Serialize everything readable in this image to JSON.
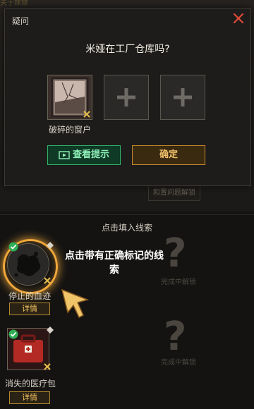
{
  "background": {
    "top_text": "关于妹妹",
    "hint_button": "和置问题解锁",
    "locked_q": "?",
    "locked_sub_1": "完成中解锁",
    "locked_sub_2": "完成中解锁"
  },
  "dialog": {
    "title": "疑问",
    "question": "米娅在工厂仓库吗?",
    "slots": [
      {
        "label": "破碎的窗户",
        "filled": true
      },
      {
        "label": "",
        "filled": false
      },
      {
        "label": "",
        "filled": false
      }
    ],
    "hint_button": "查看提示",
    "confirm_button": "确定"
  },
  "panel": {
    "title": "点击填入线索",
    "tip": "点击带有正确标记的线索",
    "clues": [
      {
        "name": "停止的血迹",
        "detail": "详情"
      },
      {
        "name": "消失的医疗包",
        "detail": "详情"
      }
    ]
  },
  "colors": {
    "accent_green": "#31b46a",
    "accent_gold": "#c88a2c",
    "close_red": "#e04a3a"
  }
}
